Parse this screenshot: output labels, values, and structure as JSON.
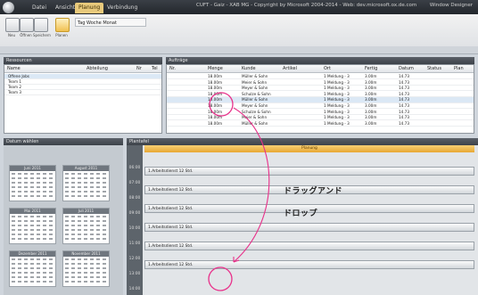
{
  "window": {
    "title": "CUFT - Gaiz - XAB MG - Copyright by Microsoft 2004-2014 - Web: dev.microsoft.ox.de.com",
    "right_text": "Window  Designer"
  },
  "menu": {
    "tabs": [
      "Datei",
      "Ansicht",
      "Planung",
      "Verbindung"
    ],
    "active_index": 2
  },
  "ribbon": {
    "buttons": [
      "Neu",
      "Öffnen",
      "Speichern",
      "Planen"
    ],
    "group_label": "Tag Woche Monat"
  },
  "resources": {
    "header": "Ressourcen",
    "columns": [
      "Name",
      "Abteilung",
      "Nr",
      "Tel"
    ],
    "items": [
      "Offene Jobs",
      "Team 1",
      "Team 2",
      "Team 3"
    ]
  },
  "jobs": {
    "header": "Aufträge",
    "columns": [
      "Nr.",
      "Menge",
      "Kunde",
      "Artikel",
      "Ort",
      "Fertig",
      "Datum",
      "Status",
      "Plan"
    ],
    "rows": [
      {
        "qty": "18.00m",
        "cust": "Müller & Sohn",
        "ref": "1 Meldung - 3",
        "val": "3.00m",
        "date": "14.73"
      },
      {
        "qty": "18.00m",
        "cust": "Meier & Sohn",
        "ref": "1 Meldung - 3",
        "val": "3.00m",
        "date": "14.73"
      },
      {
        "qty": "18.00m",
        "cust": "Meyer & Sohn",
        "ref": "1 Meldung - 3",
        "val": "3.00m",
        "date": "14.73"
      },
      {
        "qty": "18.00m",
        "cust": "Schulze & Sohn",
        "ref": "1 Meldung - 3",
        "val": "3.00m",
        "date": "14.73"
      },
      {
        "qty": "18.00m",
        "cust": "Müller & Sohn",
        "ref": "1 Meldung - 3",
        "val": "3.00m",
        "date": "14.73"
      },
      {
        "qty": "18.00m",
        "cust": "Meyer & Sohn",
        "ref": "1 Meldung - 3",
        "val": "3.00m",
        "date": "14.73"
      },
      {
        "qty": "18.00m",
        "cust": "Schulze & Sohn",
        "ref": "1 Meldung - 3",
        "val": "3.00m",
        "date": "14.73"
      },
      {
        "qty": "18.00m",
        "cust": "Meier & Sohn",
        "ref": "1 Meldung - 3",
        "val": "3.00m",
        "date": "14.73"
      },
      {
        "qty": "18.00m",
        "cust": "Müller & Sohn",
        "ref": "1 Meldung - 3",
        "val": "3.00m",
        "date": "14.73"
      }
    ]
  },
  "date_picker": {
    "header": "Datum wählen",
    "months": [
      "Juni 2011",
      "August 2011",
      "Mai 2011",
      "Juli 2011",
      "Dezember 2011",
      "November 2011"
    ]
  },
  "scheduler": {
    "header": "Plantafel",
    "column_title": "Planung",
    "times": [
      "06:00",
      "07:00",
      "08:00",
      "09:00",
      "10:00",
      "11:00",
      "12:00",
      "13:00",
      "14:00"
    ],
    "events": [
      "1.Arbeitsdienst 12 Std.",
      "1.Arbeitsdienst 12 Std.",
      "1.Arbeitsdienst 12 Std.",
      "1.Arbeitsdienst 12 Std.",
      "1.Arbeitsdienst 12 Std.",
      "1.Arbeitsdienst 12 Std."
    ]
  },
  "annotation": {
    "line1": "ドラッグアンド",
    "line2": "ドロップ",
    "color": "#e8308a"
  }
}
